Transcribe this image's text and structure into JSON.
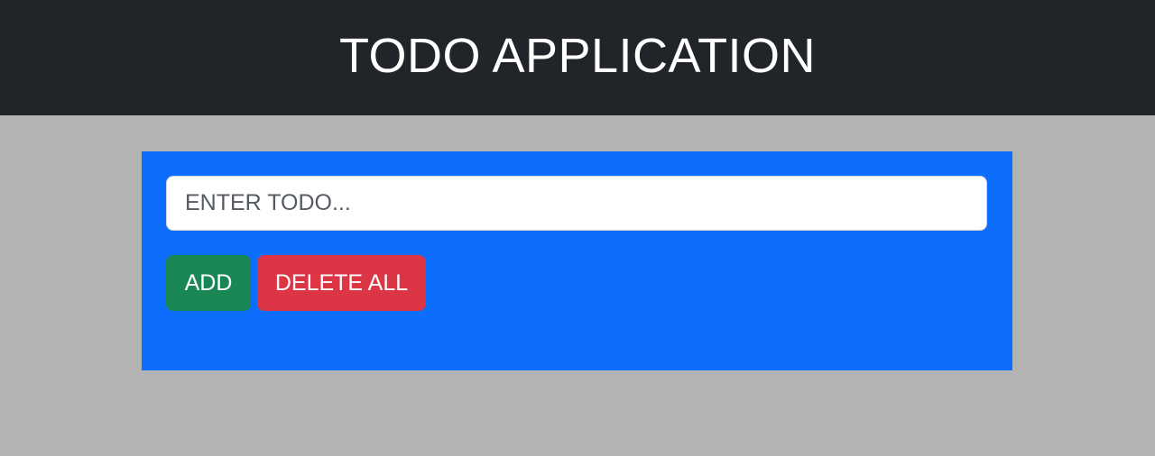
{
  "header": {
    "title": "TODO APPLICATION"
  },
  "todo_form": {
    "input_value": "",
    "input_placeholder": "ENTER TODO...",
    "add_label": "ADD",
    "delete_all_label": "DELETE ALL"
  },
  "colors": {
    "header_bg": "#212529",
    "page_bg": "#b3b3b3",
    "panel_bg": "#0d6efd",
    "add_button": "#198754",
    "delete_button": "#dc3545"
  }
}
